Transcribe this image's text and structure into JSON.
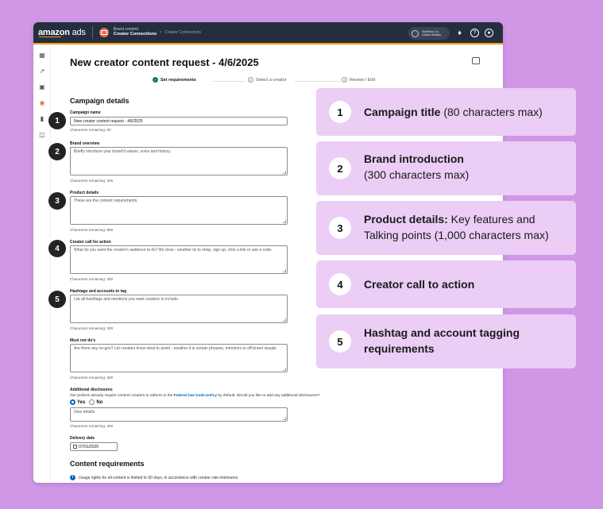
{
  "topbar": {
    "logo_brand": "amazon",
    "logo_suffix": "ads",
    "breadcrumb_parent": "Brand content",
    "breadcrumb_section": "Creator Connections",
    "breadcrumb_current": "Creator Connections",
    "account_name": "Nutrition Co.",
    "account_region": "United States"
  },
  "page": {
    "title": "New creator content request - 4/6/2025"
  },
  "steps": [
    {
      "label": "Set requirements",
      "number": "1",
      "active": true
    },
    {
      "label": "Select a creator",
      "number": "2",
      "active": false
    },
    {
      "label": "Review / Edit",
      "number": "3",
      "active": false
    }
  ],
  "campaign": {
    "section_title": "Campaign details",
    "name_label": "Campaign name",
    "name_value": "New creator content request - 4/6/2025",
    "name_remaining": "Characters remaining: 80",
    "brand_label": "Brand overview",
    "brand_placeholder": "Briefly introduce your brand'd values, voice and history.",
    "brand_remaining": "Characters remaining: 265",
    "product_label": "Product details",
    "product_placeholder": "These are the content requirements.",
    "product_remaining": "Characters remaining: 966",
    "cta_label": "Creator call for action",
    "cta_placeholder": "What do you want the creator's audience to do? Be clear-- weather its to shop, sign up, click a link or use a code.",
    "cta_remaining": "Characters remaining: 300",
    "hashtag_label": "Hashtags and accounts to tag",
    "hashtag_placeholder": "List all hashtags and mentions you want creators to include.",
    "hashtag_remaining": "Characters remaining: 300",
    "mustnot_label": "Must not do's",
    "mustnot_placeholder": "Are there any no-gos? Let creators know what to avoid - weather it is certain phrases, mentions or off-brand visuals",
    "mustnot_remaining": "Characters remaining: 300",
    "disclosure_label": "Additional disclosures",
    "disclosure_text_before": "Our policies already require content creators to adhere to the ",
    "disclosure_link": "Federal law trade policy",
    "disclosure_text_after": " by default. Would you like to add any additional disclosures?",
    "radio_yes": "Yes",
    "radio_no": "No",
    "disclosure_placeholder": "Give details",
    "disclosure_remaining": "Characters remaining: 300",
    "delivery_label": "Delivery date",
    "delivery_value": "07/01/2025"
  },
  "content": {
    "section_title": "Content requirements",
    "info_text": "Usage rights for all content is limited to 90 days, in accordance with creator rate minimums."
  },
  "badges": [
    "1",
    "2",
    "3",
    "4",
    "5"
  ],
  "callouts": [
    {
      "number": "1",
      "bold": "Campaign title",
      "rest": " (80 characters max)"
    },
    {
      "number": "2",
      "bold": "Brand introduction",
      "rest": "(300 characters max)"
    },
    {
      "number": "3",
      "bold": "Product details:",
      "rest": " Key features and Talking points (1,000 characters max)"
    },
    {
      "number": "4",
      "bold": "Creator call to action",
      "rest": ""
    },
    {
      "number": "5",
      "bold": "Hashtag and account tagging requirements",
      "rest": ""
    }
  ],
  "colors": {
    "background": "#cf97e6",
    "callout_bg": "#ebcdf5",
    "topbar": "#232f3e",
    "accent": "#ff9900",
    "step_active": "#067d62",
    "link": "#0066c0"
  }
}
